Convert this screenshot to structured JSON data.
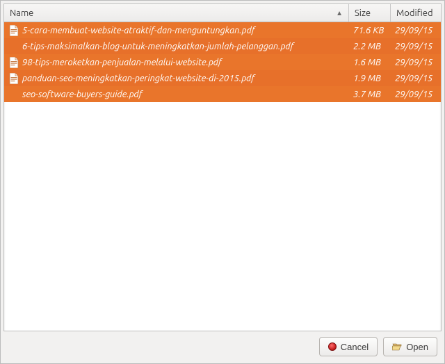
{
  "columns": {
    "name": "Name",
    "size": "Size",
    "modified": "Modified",
    "sort_indicator": "▲"
  },
  "files": [
    {
      "icon": "pdf",
      "name": "5-cara-membuat-website-atraktif-dan-menguntungkan.pdf",
      "size": "71.6 KB",
      "modified": "29/09/15"
    },
    {
      "icon": "pdf-blank",
      "name": "6-tips-maksimalkan-blog-untuk-meningkatkan-jumlah-pelanggan.pdf",
      "size": "2.2 MB",
      "modified": "29/09/15"
    },
    {
      "icon": "pdf",
      "name": "98-tips-meroketkan-penjualan-melalui-website.pdf",
      "size": "1.6 MB",
      "modified": "29/09/15"
    },
    {
      "icon": "pdf",
      "name": "panduan-seo-meningkatkan-peringkat-website-di-2015.pdf",
      "size": "1.9 MB",
      "modified": "29/09/15"
    },
    {
      "icon": "pdf-blank",
      "name": "seo-software-buyers-guide.pdf",
      "size": "3.7 MB",
      "modified": "29/09/15"
    }
  ],
  "buttons": {
    "cancel": "Cancel",
    "open": "Open"
  },
  "colors": {
    "selection0": "#e9752b",
    "selection1": "#e7702a"
  }
}
